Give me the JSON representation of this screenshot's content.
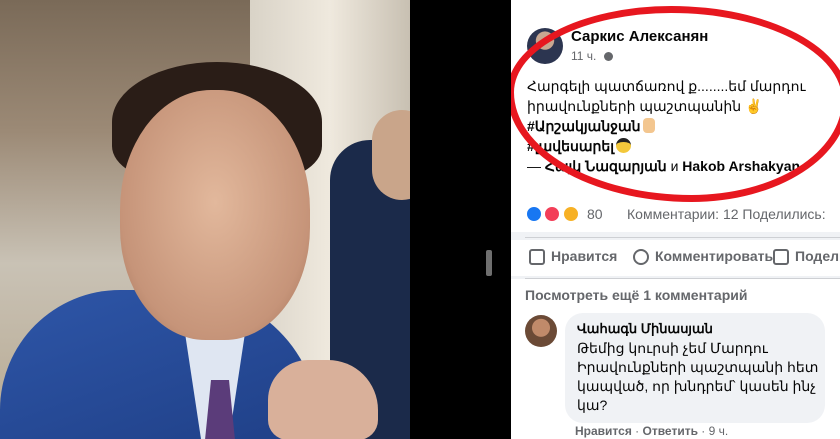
{
  "post": {
    "author": "Саркис Алексанян",
    "time": "11 ч.",
    "lines": [
      "Հարգելի պատճառով ք........եմ մարդու",
      "իրավունքների պաշտպանին ✌",
      "#Արշակյանջան",
      "#լավեսարել",
      "— Հայկ Նազարյան и Hakob Arshakyan."
    ],
    "tag_dash": "—",
    "tag_name1": "Հայկ Նազարյան",
    "tag_and": "и",
    "tag_name2": "Hakob Arshakyan."
  },
  "stats": {
    "reactions_count": "80",
    "comments": "Комментарии: 12",
    "shares": "Поделились:"
  },
  "actions": {
    "like": "Нравится",
    "comment": "Комментировать",
    "share": "Поделиться"
  },
  "comments_section": {
    "more": "Посмотреть ещё 1 комментарий",
    "comment": {
      "name": "Վահագն Մինասյան",
      "lines": [
        "Թեմից կուրսի չեմ Մարդու",
        "Իրավունքների պաշտպանի հետ",
        "կապված, որ խնդրեմ՝ կասեն ինչ",
        "կա?"
      ],
      "like": "Нравится",
      "reply": "Ответить",
      "time": "9 ч."
    }
  },
  "colors": {
    "accent": "#e7171f",
    "link": "#1877f2",
    "muted": "#65676b"
  },
  "icons": [
    "globe-icon",
    "like-icon",
    "comment-icon",
    "share-icon",
    "love-reaction-icon",
    "haha-reaction-icon"
  ]
}
